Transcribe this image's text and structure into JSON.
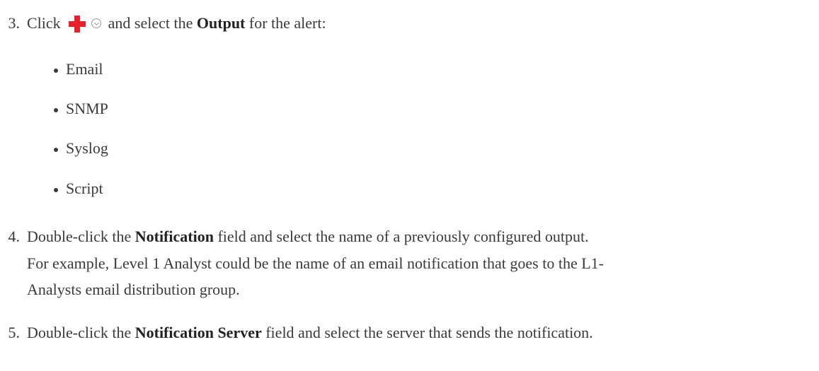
{
  "steps": [
    {
      "number": "3.",
      "click_text": "Click",
      "icons": [
        "add-icon",
        "chevron-down-circle-icon"
      ],
      "pre_bold": "and select the",
      "bold": "Output",
      "post_bold": "for the alert:",
      "outputs": [
        "Email",
        "SNMP",
        "Syslog",
        "Script"
      ]
    },
    {
      "number": "4.",
      "pre_bold": "Double-click the",
      "bold": "Notification",
      "post_bold": "field and select the name of a previously configured output.",
      "line2": "For example, Level 1 Analyst could be the name of an email notification that goes to the L1-",
      "line3": "Analysts email distribution group."
    },
    {
      "number": "5.",
      "pre_bold": "Double-click the",
      "bold": "Notification Server",
      "post_bold": "field and select the server that sends the notification."
    }
  ],
  "colors": {
    "text": "#3a3a3a",
    "plus_icon": "#e8202a",
    "chevron_icon": "#9a9a9a"
  }
}
